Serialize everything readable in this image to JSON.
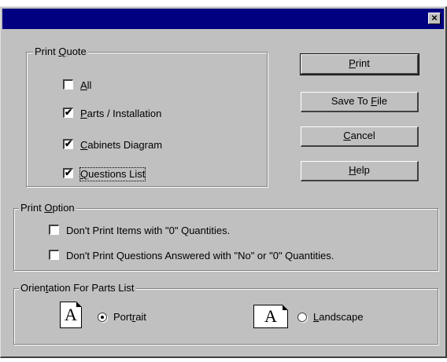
{
  "window": {
    "close_glyph": "×"
  },
  "print_quote": {
    "legend": "Print Quote",
    "items": [
      {
        "label": "All",
        "checked": false
      },
      {
        "label": "Parts / Installation",
        "checked": true
      },
      {
        "label": "Cabinets Diagram",
        "checked": true
      },
      {
        "label": "Questions List",
        "checked": true
      }
    ]
  },
  "buttons": {
    "print": "Print",
    "save_to_file": "Save To File",
    "cancel": "Cancel",
    "help": "Help"
  },
  "print_option": {
    "legend": "Print Option",
    "items": [
      {
        "label": "Don't Print Items with \"0\" Quantities.",
        "checked": false
      },
      {
        "label": "Don't Print Questions Answered with \"No\" or \"0\" Quantities.",
        "checked": false
      }
    ]
  },
  "orientation": {
    "legend": "Orientation For Parts List",
    "portrait_label": "Portrait",
    "landscape_label": "Landscape",
    "selected": "portrait",
    "icon_letter": "A"
  },
  "check_glyph": "✔"
}
